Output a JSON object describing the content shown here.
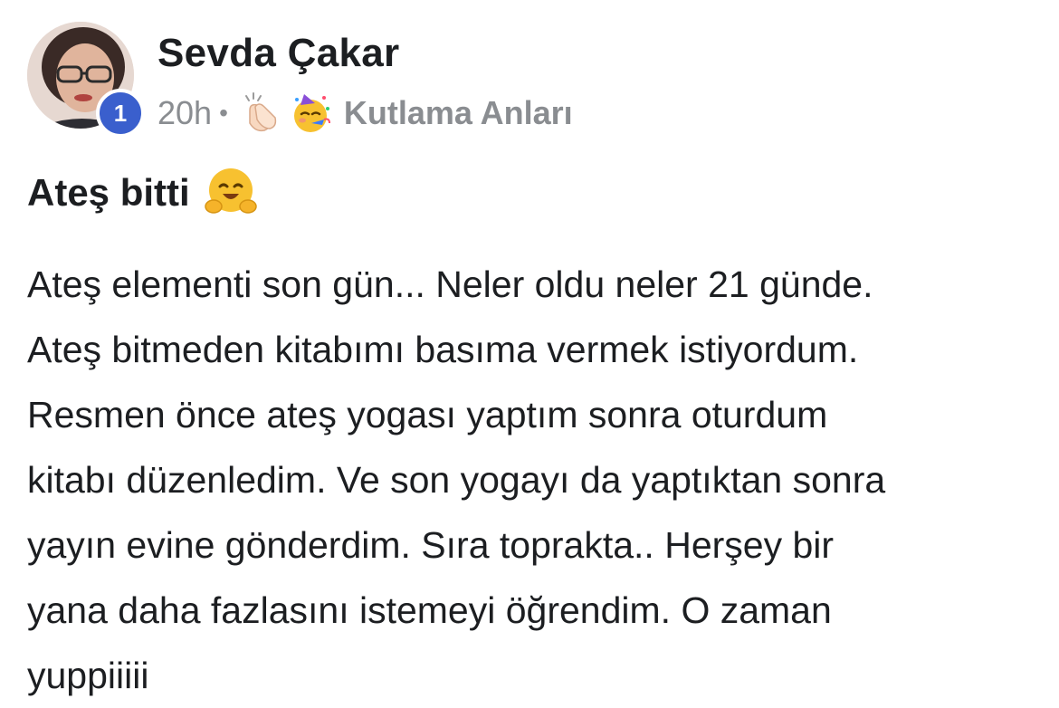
{
  "author": {
    "name": "Sevda Çakar",
    "badge_count": "1"
  },
  "meta": {
    "time": "20h",
    "separator": "•",
    "clap_icon": "clapping-hands-icon",
    "party_icon": "partying-face-icon",
    "group_name": "Kutlama Anları"
  },
  "post": {
    "title": "Ateş bitti",
    "title_icon": "hugging-face-icon",
    "lines": [
      "Ateş elementi son gün... Neler oldu neler 21 günde.",
      "Ateş bitmeden kitabımı basıma vermek istiyordum.",
      "Resmen önce ateş yogası yaptım sonra oturdum",
      "kitabı düzenledim. Ve son yogayı da yaptıktan sonra",
      "yayın evine gönderdim. Sıra toprakta.. Herşey bir",
      "yana daha fazlasını istemeyi öğrendim. O zaman",
      "yuppiiiii"
    ]
  },
  "colors": {
    "badge": "#3a5fcd",
    "meta_text": "#8a8d91",
    "body_text": "#1c1e21"
  }
}
